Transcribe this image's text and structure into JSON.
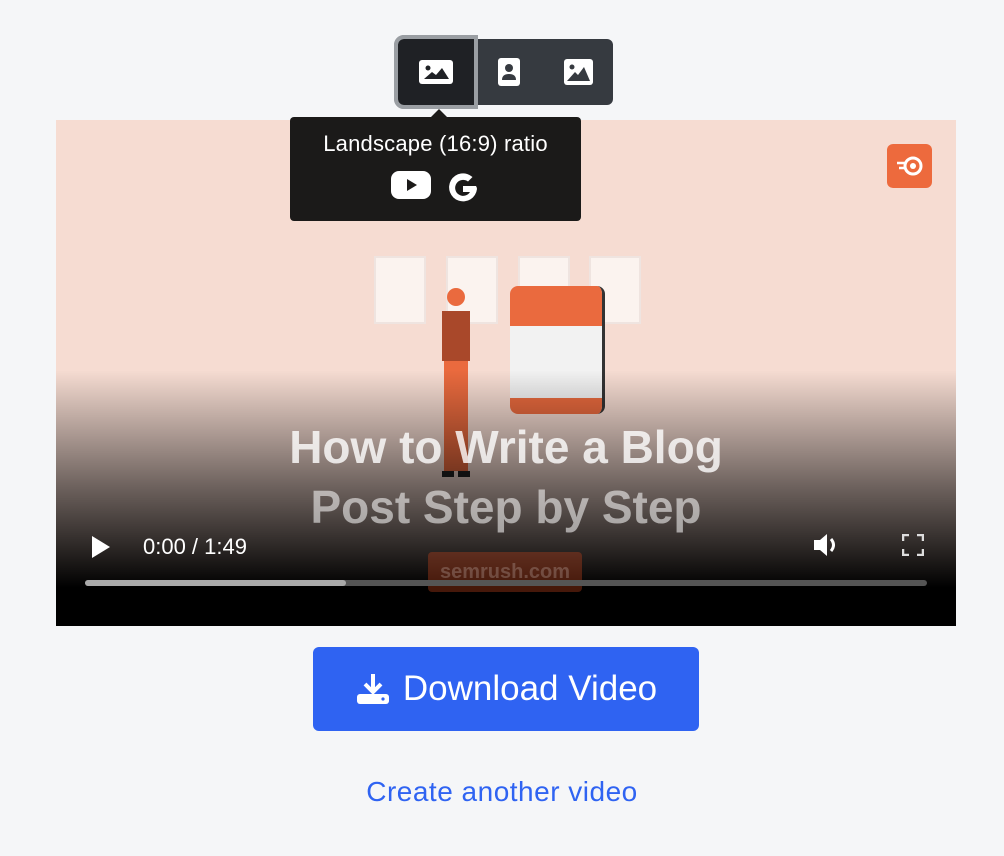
{
  "ratio_selector": {
    "options": [
      {
        "icon": "landscape-image-icon",
        "label": "Landscape (16:9) ratio",
        "active": true
      },
      {
        "icon": "portrait-person-icon",
        "active": false
      },
      {
        "icon": "square-image-icon",
        "active": false
      }
    ]
  },
  "tooltip": {
    "text": "Landscape (16:9) ratio",
    "icons": [
      "youtube-icon",
      "google-icon"
    ]
  },
  "video": {
    "title_line1": "How to Write a Blog",
    "title_line2": "Post Step by Step",
    "watermark": "semrush.com",
    "time": "0:00 / 1:49",
    "progress": 0.31,
    "brand_color": "#ED6A3D"
  },
  "download_button": {
    "label": "Download Video",
    "color": "#2F63F2"
  },
  "create_another_link": {
    "label": "Create another video"
  }
}
